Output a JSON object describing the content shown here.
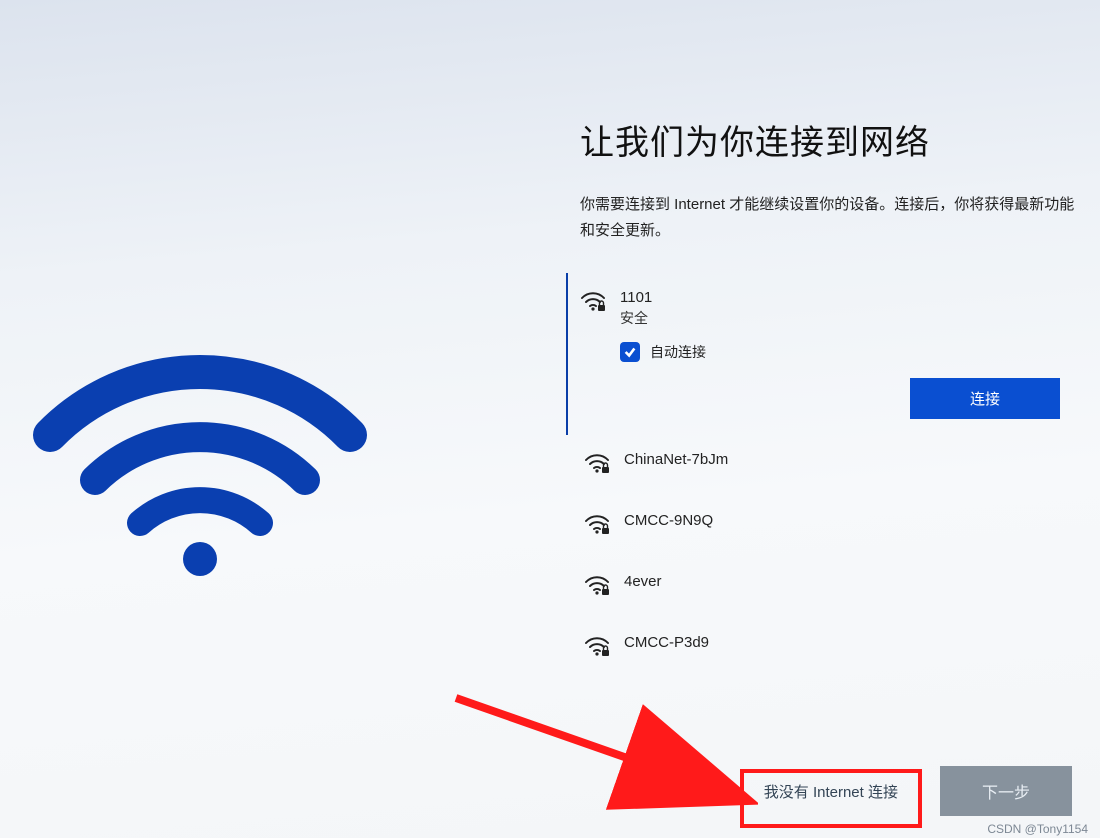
{
  "title": "让我们为你连接到网络",
  "subtitle": "你需要连接到 Internet 才能继续设置你的设备。连接后，你将获得最新功能和安全更新。",
  "auto_connect_label": "自动连接",
  "connect_button": "连接",
  "no_internet_button": "我没有 Internet 连接",
  "next_button": "下一步",
  "networks": [
    {
      "name": "1101",
      "security": "安全",
      "selected": true
    },
    {
      "name": "ChinaNet-7bJm",
      "security": "",
      "selected": false
    },
    {
      "name": "CMCC-9N9Q",
      "security": "",
      "selected": false
    },
    {
      "name": "4ever",
      "security": "",
      "selected": false
    },
    {
      "name": "CMCC-P3d9",
      "security": "",
      "selected": false
    }
  ],
  "watermark": "CSDN @Tony1154"
}
